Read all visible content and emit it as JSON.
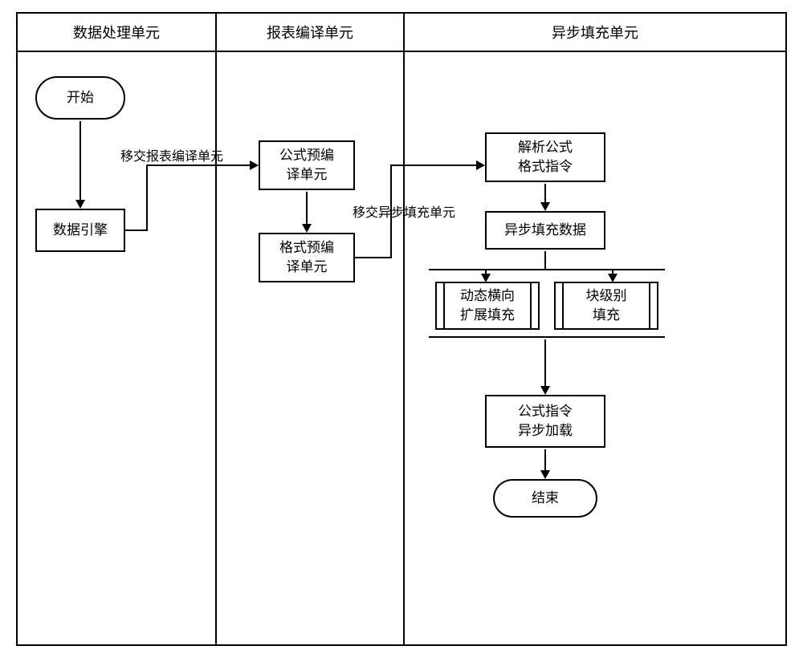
{
  "lanes": {
    "l1": "数据处理单元",
    "l2": "报表编译单元",
    "l3": "异步填充单元"
  },
  "nodes": {
    "start": "开始",
    "data_engine": "数据引擎",
    "formula_precompile": "公式预编\n译单元",
    "format_precompile": "格式预编\n译单元",
    "parse_formula_format": "解析公式\n格式指令",
    "async_fill_data": "异步填充数据",
    "dynamic_horizontal": "动态横向\n扩展填充",
    "block_level_fill": "块级别\n填充",
    "formula_async_load": "公式指令\n异步加载",
    "end": "结束"
  },
  "labels": {
    "to_compile": "移交报表编译单元",
    "to_async": "移交异步填充单元"
  }
}
